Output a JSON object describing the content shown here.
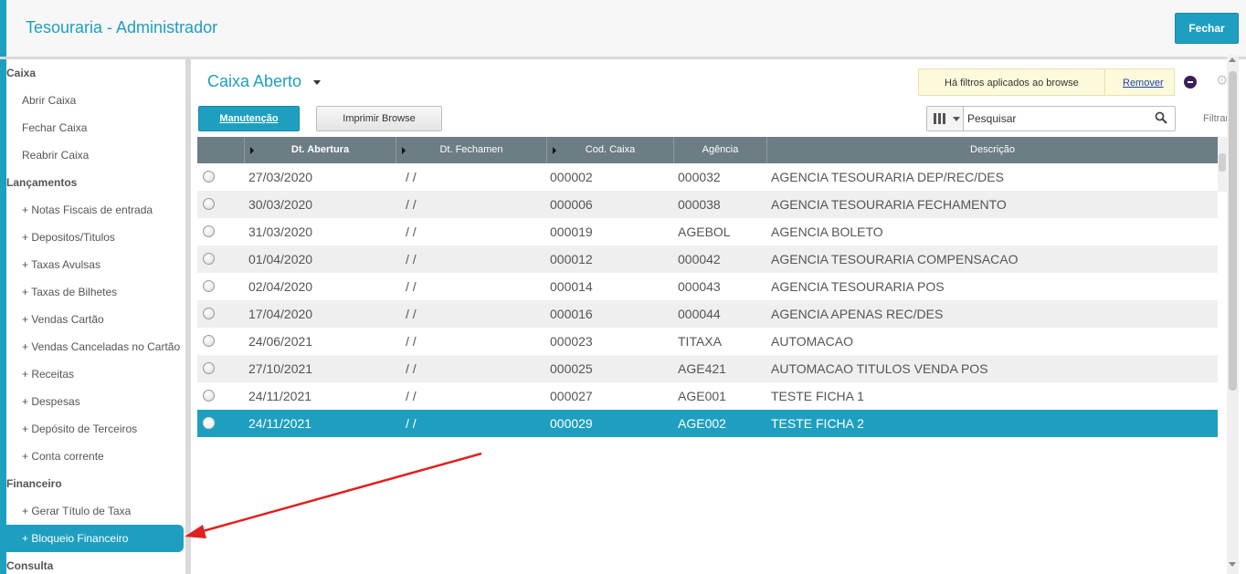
{
  "app": {
    "title": "Tesouraria - Administrador",
    "close_label": "Fechar"
  },
  "sidebar": {
    "items": [
      {
        "label": "Caixa",
        "type": "section"
      },
      {
        "label": "Abrir Caixa",
        "type": "item"
      },
      {
        "label": "Fechar Caixa",
        "type": "item"
      },
      {
        "label": "Reabrir Caixa",
        "type": "item"
      },
      {
        "label": "Lançamentos",
        "type": "section"
      },
      {
        "label": "+ Notas Fiscais de entrada",
        "type": "item"
      },
      {
        "label": "+ Depositos/Titulos",
        "type": "item"
      },
      {
        "label": "+ Taxas Avulsas",
        "type": "item"
      },
      {
        "label": "+ Taxas de Bilhetes",
        "type": "item"
      },
      {
        "label": "+ Vendas Cartão",
        "type": "item"
      },
      {
        "label": "+ Vendas Canceladas no Cartão",
        "type": "item"
      },
      {
        "label": "+ Receitas",
        "type": "item"
      },
      {
        "label": "+ Despesas",
        "type": "item"
      },
      {
        "label": "+ Depósito de Terceiros",
        "type": "item"
      },
      {
        "label": "+ Conta corrente",
        "type": "item"
      },
      {
        "label": "Financeiro",
        "type": "section"
      },
      {
        "label": "+ Gerar Título de Taxa",
        "type": "item"
      },
      {
        "label": "+ Bloqueio Financeiro",
        "type": "item",
        "active": true
      },
      {
        "label": "Consulta",
        "type": "section"
      }
    ]
  },
  "browse": {
    "title": "Caixa Aberto",
    "filter_notice": "Há filtros aplicados ao browse",
    "remove_label": "Remover",
    "maintenance_label": "Manutenção",
    "print_label": "Imprimir Browse",
    "search_placeholder": "Pesquisar",
    "filter_label": "Filtrar"
  },
  "table": {
    "columns": [
      "Dt. Abertura",
      "Dt. Fechamen",
      "Cod. Caixa",
      "Agência",
      "Descrição"
    ],
    "rows": [
      {
        "dt_abertura": "27/03/2020",
        "dt_fechamento": " /  /",
        "cod": "000002",
        "agencia": "000032",
        "descricao": "AGENCIA TESOURARIA DEP/REC/DES"
      },
      {
        "dt_abertura": "30/03/2020",
        "dt_fechamento": " /  /",
        "cod": "000006",
        "agencia": "000038",
        "descricao": "AGENCIA TESOURARIA FECHAMENTO"
      },
      {
        "dt_abertura": "31/03/2020",
        "dt_fechamento": " /  /",
        "cod": "000019",
        "agencia": "AGEBOL",
        "descricao": "AGENCIA BOLETO"
      },
      {
        "dt_abertura": "01/04/2020",
        "dt_fechamento": " /  /",
        "cod": "000012",
        "agencia": "000042",
        "descricao": "AGENCIA TESOURARIA COMPENSACAO"
      },
      {
        "dt_abertura": "02/04/2020",
        "dt_fechamento": " /  /",
        "cod": "000014",
        "agencia": "000043",
        "descricao": "AGENCIA TESOURARIA POS"
      },
      {
        "dt_abertura": "17/04/2020",
        "dt_fechamento": " /  /",
        "cod": "000016",
        "agencia": "000044",
        "descricao": "AGENCIA APENAS REC/DES"
      },
      {
        "dt_abertura": "24/06/2021",
        "dt_fechamento": " /  /",
        "cod": "000023",
        "agencia": "TITAXA",
        "descricao": "AUTOMACAO"
      },
      {
        "dt_abertura": "27/10/2021",
        "dt_fechamento": " /  /",
        "cod": "000025",
        "agencia": "AGE421",
        "descricao": "AUTOMACAO TITULOS VENDA POS"
      },
      {
        "dt_abertura": "24/11/2021",
        "dt_fechamento": " /  /",
        "cod": "000027",
        "agencia": "AGE001",
        "descricao": "TESTE FICHA 1"
      },
      {
        "dt_abertura": "24/11/2021",
        "dt_fechamento": " /  /",
        "cod": "000029",
        "agencia": "AGE002",
        "descricao": "TESTE FICHA 2",
        "selected": true
      }
    ]
  },
  "colors": {
    "accent": "#1e9fc0",
    "header": "#6c7d84",
    "annotation_arrow": "#e02020"
  }
}
